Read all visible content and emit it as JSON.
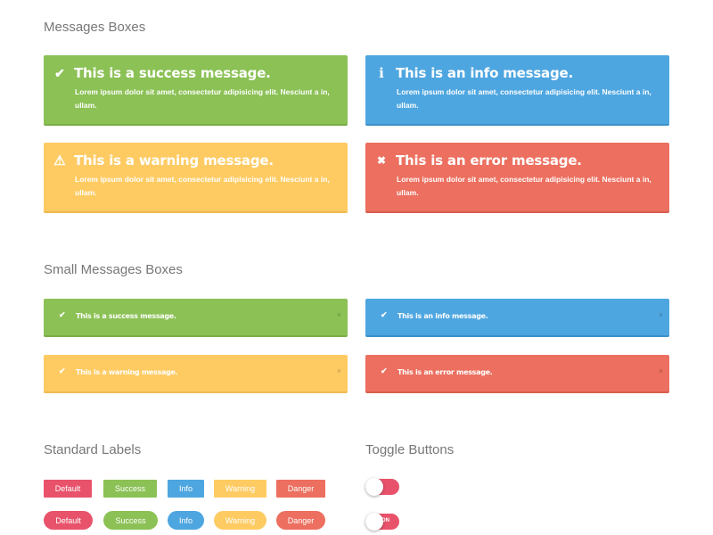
{
  "sections": {
    "messages_title": "Messages Boxes",
    "small_title": "Small Messages Boxes",
    "labels_title": "Standard Labels",
    "toggles_title": "Toggle Buttons"
  },
  "messages": [
    {
      "type": "success",
      "icon": "check-icon",
      "glyph": "✔",
      "title": "This is a success message.",
      "body": "Lorem ipsum dolor sit amet, consectetur adipisicing elit. Nesciunt a in, ullam."
    },
    {
      "type": "info",
      "icon": "info-icon",
      "glyph": "i",
      "title": "This is an info message.",
      "body": "Lorem ipsum dolor sit amet, consectetur adipisicing elit. Nesciunt a in, ullam."
    },
    {
      "type": "warning",
      "icon": "warning-icon",
      "glyph": "⚠",
      "title": "This is a warning message.",
      "body": "Lorem ipsum dolor sit amet, consectetur adipisicing elit. Nesciunt a in, ullam."
    },
    {
      "type": "error",
      "icon": "close-icon",
      "glyph": "✖",
      "title": "This is an error message.",
      "body": "Lorem ipsum dolor sit amet, consectetur adipisicing elit. Nesciunt a in, ullam."
    }
  ],
  "small_messages": [
    {
      "type": "success",
      "check": "✔",
      "text": "This is a success message.",
      "close": "×"
    },
    {
      "type": "info",
      "check": "✔",
      "text": "This is an info message.",
      "close": "×"
    },
    {
      "type": "warning",
      "check": "✔",
      "text": "This is a warning message.",
      "close": "×"
    },
    {
      "type": "error",
      "check": "✔",
      "text": "This is an error message.",
      "close": "×"
    }
  ],
  "labels": {
    "square": [
      "Default",
      "Success",
      "Info",
      "Warning",
      "Danger"
    ],
    "pill": [
      "Default",
      "Success",
      "Info",
      "Warning",
      "Danger"
    ]
  },
  "toggles": [
    {
      "state": "off",
      "label": ""
    },
    {
      "state": "on",
      "label": "ON"
    }
  ],
  "colors": {
    "success": "#8bc155",
    "info": "#4ea6e0",
    "warning": "#fecb63",
    "error": "#ec6f5f",
    "default": "#e8526b"
  }
}
